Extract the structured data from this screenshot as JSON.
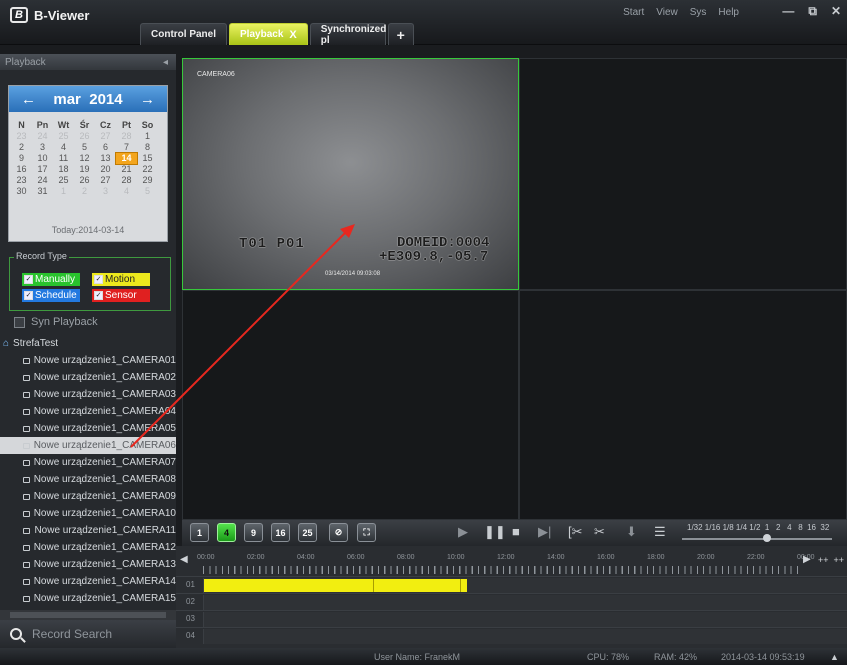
{
  "app": {
    "title": "B-Viewer",
    "logo_letter": "B"
  },
  "menu": [
    "Start",
    "View",
    "Sys",
    "Help"
  ],
  "window_controls": [
    "—",
    "⧉",
    "✕"
  ],
  "tabs": [
    {
      "label": "Control Panel"
    },
    {
      "label": "Playback",
      "active": true,
      "close": "X"
    },
    {
      "label": "Synchronized pl"
    },
    {
      "label": "+"
    }
  ],
  "left_panel": {
    "header": "Playback",
    "collapse": "◂",
    "calendar": {
      "prev": "←",
      "month_year": "mar  2014",
      "next": "→",
      "weekdays": [
        "N",
        "Pn",
        "Wt",
        "Śr",
        "Cz",
        "Pt",
        "So"
      ],
      "days": [
        [
          "23",
          "other"
        ],
        [
          "24",
          "other"
        ],
        [
          "25",
          "other"
        ],
        [
          "26",
          "other"
        ],
        [
          "27",
          "other"
        ],
        [
          "28",
          "other"
        ],
        [
          "1",
          ""
        ],
        [
          "2",
          ""
        ],
        [
          "3",
          ""
        ],
        [
          "4",
          ""
        ],
        [
          "5",
          ""
        ],
        [
          "6",
          ""
        ],
        [
          "7",
          ""
        ],
        [
          "8",
          ""
        ],
        [
          "9",
          ""
        ],
        [
          "10",
          ""
        ],
        [
          "11",
          ""
        ],
        [
          "12",
          ""
        ],
        [
          "13",
          ""
        ],
        [
          "14",
          "today"
        ],
        [
          "15",
          ""
        ],
        [
          "16",
          ""
        ],
        [
          "17",
          ""
        ],
        [
          "18",
          ""
        ],
        [
          "19",
          ""
        ],
        [
          "20",
          ""
        ],
        [
          "21",
          ""
        ],
        [
          "22",
          ""
        ],
        [
          "23",
          ""
        ],
        [
          "24",
          ""
        ],
        [
          "25",
          ""
        ],
        [
          "26",
          ""
        ],
        [
          "27",
          ""
        ],
        [
          "28",
          ""
        ],
        [
          "29",
          ""
        ],
        [
          "30",
          ""
        ],
        [
          "31",
          ""
        ],
        [
          "1",
          "other"
        ],
        [
          "2",
          "other"
        ],
        [
          "3",
          "other"
        ],
        [
          "4",
          "other"
        ],
        [
          "5",
          "other"
        ]
      ],
      "today_label": "Today:2014-03-14"
    },
    "record_type": {
      "label": "Record Type",
      "manually": "Manually",
      "motion": "Motion",
      "schedule": "Schedule",
      "sensor": "Sensor",
      "colors": {
        "manually": "#29c22d",
        "motion": "#ece81d",
        "schedule": "#2379e0",
        "sensor": "#e02020"
      }
    },
    "syn_playback": "Syn Playback",
    "tree_root": "StrefaTest",
    "cameras": [
      "Nowe urządzenie1_CAMERA01",
      "Nowe urządzenie1_CAMERA02",
      "Nowe urządzenie1_CAMERA03",
      "Nowe urządzenie1_CAMERA04",
      "Nowe urządzenie1_CAMERA05",
      "Nowe urządzenie1_CAMERA06",
      "Nowe urządzenie1_CAMERA07",
      "Nowe urządzenie1_CAMERA08",
      "Nowe urządzenie1_CAMERA09",
      "Nowe urządzenie1_CAMERA10",
      "Nowe urządzenie1_CAMERA11",
      "Nowe urządzenie1_CAMERA12",
      "Nowe urządzenie1_CAMERA13",
      "Nowe urządzenie1_CAMERA14",
      "Nowe urządzenie1_CAMERA15",
      "Nowe urządzenie1_CAMERA16"
    ],
    "selected_camera_index": 5,
    "record_search": "Record Search"
  },
  "video": {
    "camera_label": "CAMERA06",
    "osd_left": "T01 P01",
    "osd_right1": "DOMEID:0004",
    "osd_right2": "+E309.8,-05.7",
    "osd_time": "03/14/2014 09:03:08"
  },
  "toolbar": {
    "layouts": [
      "1",
      "4",
      "9",
      "16",
      "25"
    ],
    "speed_labels": "1/32 1/16 1/8 1/4 1/2  1   2   4   8  16  32",
    "speed_value": "1"
  },
  "timeline": {
    "hours": [
      "00:00",
      "02:00",
      "04:00",
      "06:00",
      "08:00",
      "10:00",
      "12:00",
      "14:00",
      "16:00",
      "18:00",
      "20:00",
      "22:00",
      "00:00"
    ],
    "rows": [
      "01",
      "02",
      "03",
      "04"
    ],
    "recordings": [
      {
        "row": 0,
        "start_hour": 0.0,
        "end_hour": 10.5,
        "gaps": [
          6.75,
          10.25
        ]
      }
    ],
    "nav_prev": "◀",
    "nav_next": "▶",
    "zoom": "++  ++"
  },
  "status": {
    "user": "User Name: FranekM",
    "cpu": "CPU: 78%",
    "ram": "RAM: 42%",
    "datetime": "2014-03-14 09:53:19",
    "arrow": "▲"
  }
}
